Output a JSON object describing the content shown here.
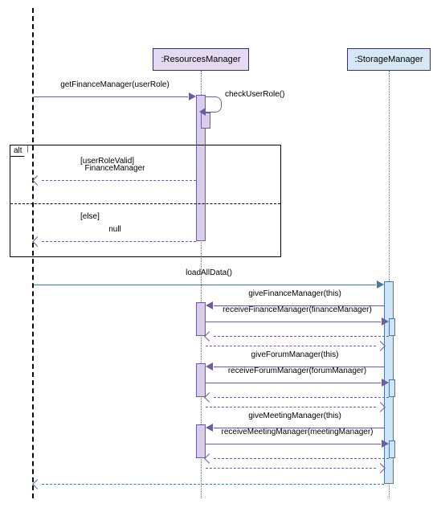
{
  "participants": {
    "resources": ":ResourcesManager",
    "storage": ":StorageManager"
  },
  "messages": {
    "getFinanceManager": "getFinanceManager(userRole)",
    "checkUserRole": "checkUserRole()",
    "financeManager": "FinanceManager",
    "nullReturn": "null",
    "loadAllData": "loadAllData()",
    "giveFinanceManager": "giveFinanceManager(this)",
    "receiveFinanceManager": "receiveFinanceManager(financeManager)",
    "giveForumManager": "giveForumManager(this)",
    "receiveForumManager": "receiveForumManager(forumManager)",
    "giveMeetingManager": "giveMeetingManager(this)",
    "receiveMeetingManager": "receiveMeetingManager(meetingManager)"
  },
  "fragment": {
    "tag": "alt",
    "guard1": "[userRoleValid]",
    "guard2": "[else]"
  }
}
